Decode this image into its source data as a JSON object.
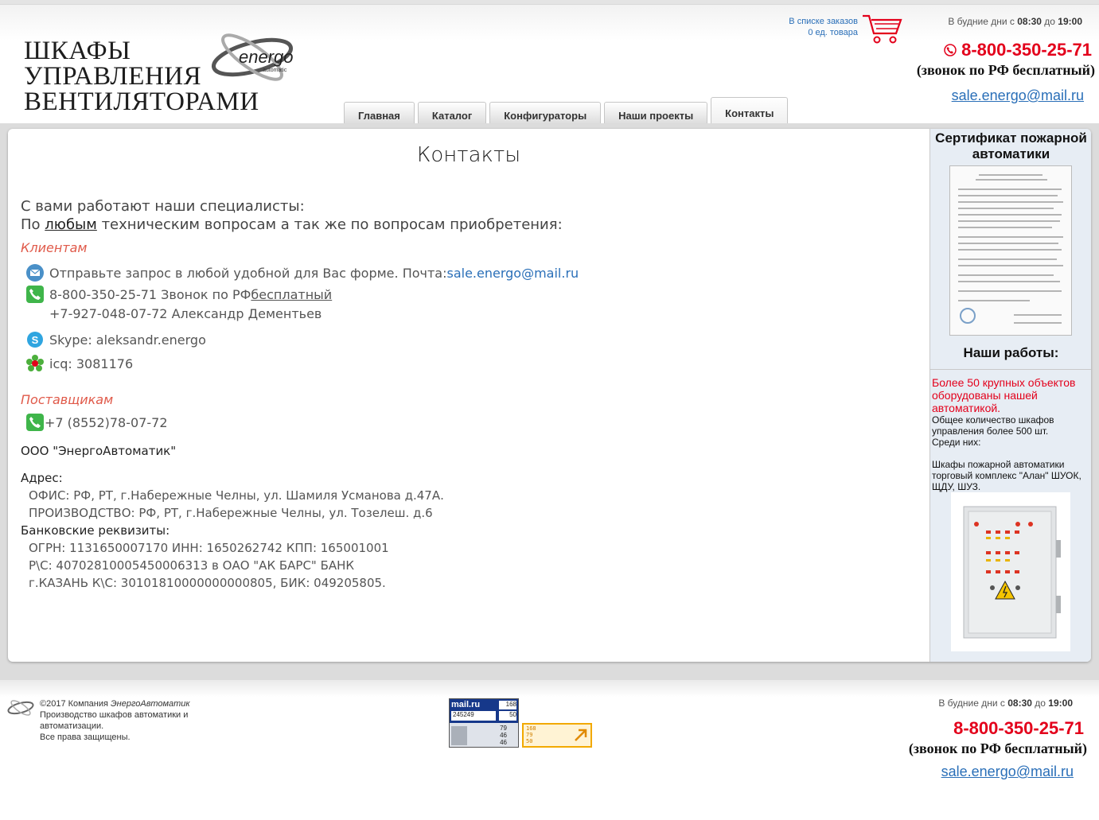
{
  "header": {
    "logo_lines": [
      "ШКАФЫ",
      "УПРАВЛЕНИЯ",
      "ВЕНТИЛЯТОРАМИ"
    ],
    "logo_brand": "energo",
    "logo_sub": "automatic",
    "cart_line1": "В списке заказов",
    "cart_line2": "0 ед. товара",
    "hours_prefix": "В будние дни с",
    "hours_from": "08:30",
    "hours_mid": "до",
    "hours_to": "19:00",
    "phone": "8-800-350-25-71",
    "phone_note": "(звонок по РФ бесплатный)",
    "email": "sale.energo@mail.ru"
  },
  "nav": {
    "tabs": [
      "Главная",
      "Каталог",
      "Конфигураторы",
      "Наши проекты",
      "Контакты"
    ],
    "active": "Контакты"
  },
  "main": {
    "title": "Контакты",
    "intro1": "С вами работают наши специалисты:",
    "intro2_a": "По ",
    "intro2_u": "любым",
    "intro2_b": " техническим вопросам а так же по вопросам приобретения:",
    "clients_heading": "Клиентам",
    "mail_text": "Отправьте запрос в любой удобной для Вас форме. Почта: ",
    "mail_link": "sale.energo@mail.ru",
    "phone_text": "8-800-350-25-71 Звонок по РФ ",
    "phone_free": "бесплатный",
    "mobile_text": "+7-927-048-07-72 Александр Дементьев",
    "skype_text": "Skype: aleksandr.energo",
    "icq_text": "icq: 3081176",
    "suppliers_heading": "Поставщикам",
    "supplier_phone": "+7 (8552)78-07-72",
    "company": "ООО \"ЭнергоАвтоматик\"",
    "address_heading": "Адрес:",
    "office": "ОФИС:  РФ, РТ, г.Набережные Челны, ул. Шамиля Усманова д.47А.",
    "production": "ПРОИЗВОДСТВО:  РФ, РТ, г.Набережные Челны, ул. Тозелеш. д.6",
    "bank_heading": "Банковские реквизиты:",
    "bank1": "ОГРН: 1131650007170  ИНН: 1650262742  КПП: 165001001",
    "bank2": "Р\\С: 40702810005450006313 в ОАО \"АК БАРС\" БАНК",
    "bank3": "г.КАЗАНЬ К\\С: 30101810000000000805,  БИК: 049205805."
  },
  "sidebar": {
    "cert_heading": "Сертификат пожарной автоматики",
    "works_heading": "Наши работы:",
    "red_text": "Более 50 крупных объектов оборудованы нашей автоматикой.",
    "total_text": "Общее количество шкафов управления более 500 шт.",
    "among": "Среди них:",
    "project_text": "Шкафы пожарной автоматики торговый комплекс \"Алан\" ШУОК, ЩДУ, ШУЗ."
  },
  "footer": {
    "copyright": "©2017 Компания ",
    "company_italic": "ЭнергоАвтоматик",
    "line2": "Производство шкафов автоматики и автоматизации.",
    "line3": "Все права защищены.",
    "counter_brand": "mail.ru",
    "counter_a": "168",
    "counter_b": "245249",
    "counter_c": "50",
    "counter_d": "79",
    "counter_e": "46",
    "counter_f": "46",
    "li_a": "168",
    "li_b": "79",
    "li_c": "50",
    "hours_prefix": "В будние дни с",
    "hours_from": "08:30",
    "hours_mid": "до",
    "hours_to": "19:00",
    "phone": "8-800-350-25-71",
    "phone_note": "(звонок по РФ бесплатный)",
    "email": "sale.energo@mail.ru"
  },
  "colors": {
    "accent_red": "#e3001b",
    "link_blue": "#2a6fb8",
    "section_red": "#e05a4a",
    "sidebar_bg": "#e7edf4"
  }
}
